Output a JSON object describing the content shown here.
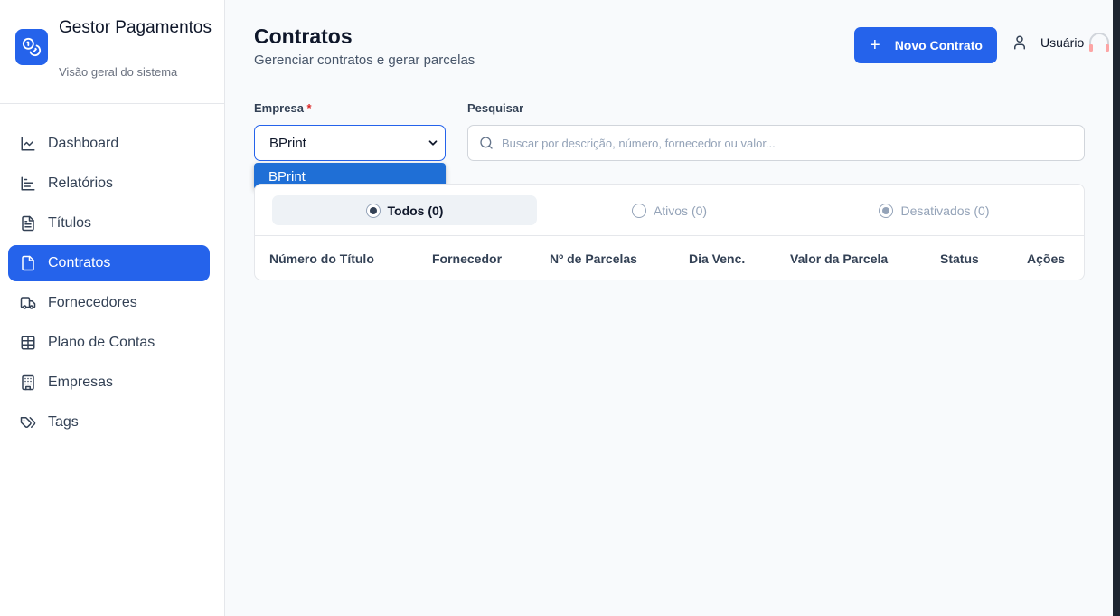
{
  "brand": {
    "title": "Gestor Pagamentos",
    "subtitle": "Visão geral do sistema",
    "logo_icon": "coins-icon"
  },
  "nav": [
    {
      "label": "Dashboard",
      "icon": "line-chart-icon",
      "active": false
    },
    {
      "label": "Relatórios",
      "icon": "bar-chart-icon",
      "active": false
    },
    {
      "label": "Títulos",
      "icon": "file-text-icon",
      "active": false
    },
    {
      "label": "Contratos",
      "icon": "file-icon",
      "active": true
    },
    {
      "label": "Fornecedores",
      "icon": "truck-icon",
      "active": false
    },
    {
      "label": "Plano de Contas",
      "icon": "table-icon",
      "active": false
    },
    {
      "label": "Empresas",
      "icon": "building-icon",
      "active": false
    },
    {
      "label": "Tags",
      "icon": "tags-icon",
      "active": false
    }
  ],
  "header": {
    "title": "Contratos",
    "subtitle": "Gerenciar contratos e gerar parcelas",
    "new_button": "Novo Contrato",
    "user_label": "Usuário"
  },
  "form": {
    "empresa_label": "Empresa",
    "required_mark": "*",
    "empresa_value": "BPrint",
    "empresa_options": [
      "BPrint"
    ],
    "search_label": "Pesquisar",
    "search_placeholder": "Buscar por descrição, número, fornecedor ou valor..."
  },
  "filters": [
    {
      "label": "Todos (0)",
      "selected": true
    },
    {
      "label": "Ativos (0)",
      "selected": false
    },
    {
      "label": "Desativados (0)",
      "selected": false
    }
  ],
  "table": {
    "columns": [
      "Número do Título",
      "Fornecedor",
      "Nº de Parcelas",
      "Dia Venc.",
      "Valor da Parcela",
      "Status",
      "Ações"
    ],
    "rows": []
  },
  "colors": {
    "accent": "#2563eb",
    "dropdown_highlight": "#1f6fd6",
    "required": "#dc2626"
  }
}
